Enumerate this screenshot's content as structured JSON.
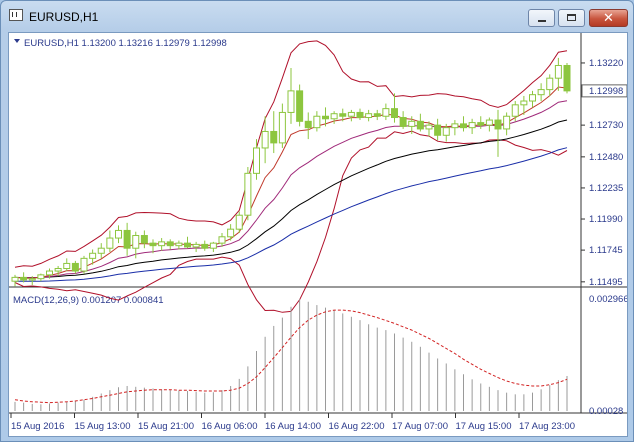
{
  "window": {
    "title": "EURUSD,H1",
    "buttons": {
      "minimize": "minimize",
      "maximize": "maximize",
      "close": "✕"
    }
  },
  "price_panel": {
    "header": "EURUSD,H1  1.13200 1.13216 1.12979 1.12998",
    "current_price": "1.12998",
    "y_ticks": [
      "1.13220",
      "1.12730",
      "1.12480",
      "1.12235",
      "1.11990",
      "1.11745",
      "1.11495"
    ]
  },
  "macd_panel": {
    "header": "MACD(12,26,9) 0.001207 0.000841",
    "y_ticks": [
      "0.002966",
      "0.00028"
    ]
  },
  "x_ticks": [
    "15 Aug 2016",
    "15 Aug 13:00",
    "15 Aug 21:00",
    "16 Aug 06:00",
    "16 Aug 14:00",
    "16 Aug 22:00",
    "17 Aug 07:00",
    "17 Aug 15:00",
    "17 Aug 23:00"
  ],
  "colors": {
    "bull_candle": "#8dc63f",
    "bear_candle": "#8dc63f",
    "boll_band": "#b0102a",
    "ma_fast": "#c0392b",
    "ma_mid": "#a02a7a",
    "ma_black": "#000000",
    "ma_blue": "#1a2ea8",
    "macd_hist": "#9a9a9a",
    "macd_signal": "#d22222",
    "axis_text": "#2b3a8c"
  },
  "chart_data": {
    "type": "candlestick",
    "price_range": [
      1.1147,
      1.1333
    ],
    "candles": [
      [
        1.115,
        1.1155,
        1.1146,
        1.1153
      ],
      [
        1.1153,
        1.1157,
        1.1149,
        1.1151
      ],
      [
        1.1151,
        1.1154,
        1.1147,
        1.1152
      ],
      [
        1.1152,
        1.1156,
        1.115,
        1.1155
      ],
      [
        1.1155,
        1.116,
        1.1152,
        1.1158
      ],
      [
        1.1158,
        1.1162,
        1.1154,
        1.116
      ],
      [
        1.116,
        1.1168,
        1.1158,
        1.1164
      ],
      [
        1.1164,
        1.1166,
        1.1156,
        1.1158
      ],
      [
        1.1158,
        1.117,
        1.1156,
        1.1168
      ],
      [
        1.1168,
        1.1175,
        1.1163,
        1.1172
      ],
      [
        1.1172,
        1.118,
        1.1168,
        1.1176
      ],
      [
        1.1176,
        1.119,
        1.1173,
        1.1184
      ],
      [
        1.1184,
        1.1194,
        1.118,
        1.119
      ],
      [
        1.119,
        1.1196,
        1.117,
        1.1176
      ],
      [
        1.1176,
        1.1189,
        1.1168,
        1.1186
      ],
      [
        1.1186,
        1.119,
        1.1176,
        1.118
      ],
      [
        1.118,
        1.1183,
        1.1172,
        1.1178
      ],
      [
        1.1178,
        1.1184,
        1.1174,
        1.1181
      ],
      [
        1.1181,
        1.1183,
        1.1175,
        1.1178
      ],
      [
        1.1178,
        1.1182,
        1.1175,
        1.118
      ],
      [
        1.118,
        1.1185,
        1.1176,
        1.1177
      ],
      [
        1.1177,
        1.1181,
        1.1173,
        1.1179
      ],
      [
        1.1179,
        1.1182,
        1.1174,
        1.1176
      ],
      [
        1.1176,
        1.1181,
        1.1173,
        1.118
      ],
      [
        1.118,
        1.1188,
        1.1177,
        1.1185
      ],
      [
        1.1185,
        1.1195,
        1.1182,
        1.1191
      ],
      [
        1.1191,
        1.1205,
        1.1188,
        1.1202
      ],
      [
        1.1202,
        1.124,
        1.1198,
        1.1235
      ],
      [
        1.1235,
        1.1262,
        1.123,
        1.1255
      ],
      [
        1.1255,
        1.128,
        1.1243,
        1.1268
      ],
      [
        1.1268,
        1.1284,
        1.1251,
        1.1259
      ],
      [
        1.1259,
        1.129,
        1.1255,
        1.1283
      ],
      [
        1.1283,
        1.1318,
        1.1274,
        1.13
      ],
      [
        1.13,
        1.1305,
        1.1272,
        1.1276
      ],
      [
        1.1276,
        1.1283,
        1.1262,
        1.1271
      ],
      [
        1.1271,
        1.1284,
        1.1268,
        1.128
      ],
      [
        1.128,
        1.1287,
        1.1272,
        1.1278
      ],
      [
        1.1278,
        1.1284,
        1.1274,
        1.1282
      ],
      [
        1.1282,
        1.1286,
        1.1276,
        1.128
      ],
      [
        1.128,
        1.1285,
        1.1276,
        1.1283
      ],
      [
        1.1283,
        1.1286,
        1.1277,
        1.1279
      ],
      [
        1.1279,
        1.1285,
        1.1276,
        1.1282
      ],
      [
        1.1282,
        1.1285,
        1.1277,
        1.128
      ],
      [
        1.128,
        1.129,
        1.1277,
        1.1286
      ],
      [
        1.1286,
        1.1298,
        1.1275,
        1.1279
      ],
      [
        1.1279,
        1.1284,
        1.127,
        1.1272
      ],
      [
        1.1272,
        1.128,
        1.1266,
        1.1276
      ],
      [
        1.1276,
        1.1282,
        1.1268,
        1.127
      ],
      [
        1.127,
        1.1276,
        1.1264,
        1.1273
      ],
      [
        1.1273,
        1.1278,
        1.1261,
        1.1265
      ],
      [
        1.1265,
        1.1274,
        1.126,
        1.1271
      ],
      [
        1.1271,
        1.1277,
        1.1265,
        1.1274
      ],
      [
        1.1274,
        1.128,
        1.1268,
        1.1271
      ],
      [
        1.1271,
        1.1278,
        1.1266,
        1.1275
      ],
      [
        1.1275,
        1.128,
        1.127,
        1.1273
      ],
      [
        1.1273,
        1.1279,
        1.1268,
        1.1277
      ],
      [
        1.1277,
        1.1285,
        1.1248,
        1.127
      ],
      [
        1.127,
        1.1283,
        1.1265,
        1.128
      ],
      [
        1.128,
        1.1292,
        1.1276,
        1.1289
      ],
      [
        1.1289,
        1.1296,
        1.1281,
        1.1292
      ],
      [
        1.1292,
        1.13,
        1.1287,
        1.1297
      ],
      [
        1.1297,
        1.1306,
        1.1292,
        1.1301
      ],
      [
        1.1301,
        1.1313,
        1.1296,
        1.131
      ],
      [
        1.131,
        1.1326,
        1.13,
        1.132
      ],
      [
        1.132,
        1.1322,
        1.1298,
        1.13
      ]
    ],
    "macd_range": [
      0.00028,
      0.002966
    ],
    "macd_hist": [
      0.0005,
      0.00048,
      0.00045,
      0.00044,
      0.00046,
      0.00048,
      0.0005,
      0.00052,
      0.00055,
      0.00062,
      0.0007,
      0.00078,
      0.00085,
      0.00088,
      0.00086,
      0.00084,
      0.00082,
      0.0008,
      0.00078,
      0.00077,
      0.00076,
      0.00074,
      0.00072,
      0.00073,
      0.00078,
      0.00088,
      0.00105,
      0.00135,
      0.00172,
      0.00206,
      0.00232,
      0.00252,
      0.00278,
      0.00296,
      0.0029,
      0.00282,
      0.00276,
      0.0027,
      0.00262,
      0.00254,
      0.00246,
      0.00236,
      0.00228,
      0.00222,
      0.00214,
      0.00204,
      0.00194,
      0.00182,
      0.00168,
      0.00154,
      0.00142,
      0.00128,
      0.00116,
      0.00104,
      0.00094,
      0.00086,
      0.00078,
      0.00072,
      0.00068,
      0.00068,
      0.00072,
      0.0008,
      0.0009,
      0.00102,
      0.00112
    ],
    "macd_signal": [
      0.00055,
      0.00052,
      0.0005,
      0.00049,
      0.00048,
      0.00049,
      0.0005,
      0.00052,
      0.00055,
      0.00058,
      0.00062,
      0.00066,
      0.0007,
      0.00074,
      0.00076,
      0.00078,
      0.00079,
      0.00079,
      0.00079,
      0.00078,
      0.00078,
      0.00077,
      0.00076,
      0.00076,
      0.00076,
      0.00078,
      0.00083,
      0.00094,
      0.0011,
      0.00132,
      0.00156,
      0.0018,
      0.00205,
      0.00228,
      0.00246,
      0.00258,
      0.00266,
      0.0027,
      0.0027,
      0.00268,
      0.00264,
      0.00258,
      0.00252,
      0.00245,
      0.00238,
      0.0023,
      0.00222,
      0.00212,
      0.00202,
      0.0019,
      0.00178,
      0.00166,
      0.00152,
      0.0014,
      0.00128,
      0.00118,
      0.00108,
      0.001,
      0.00094,
      0.0009,
      0.00088,
      0.00088,
      0.00091,
      0.00096,
      0.00104
    ]
  }
}
